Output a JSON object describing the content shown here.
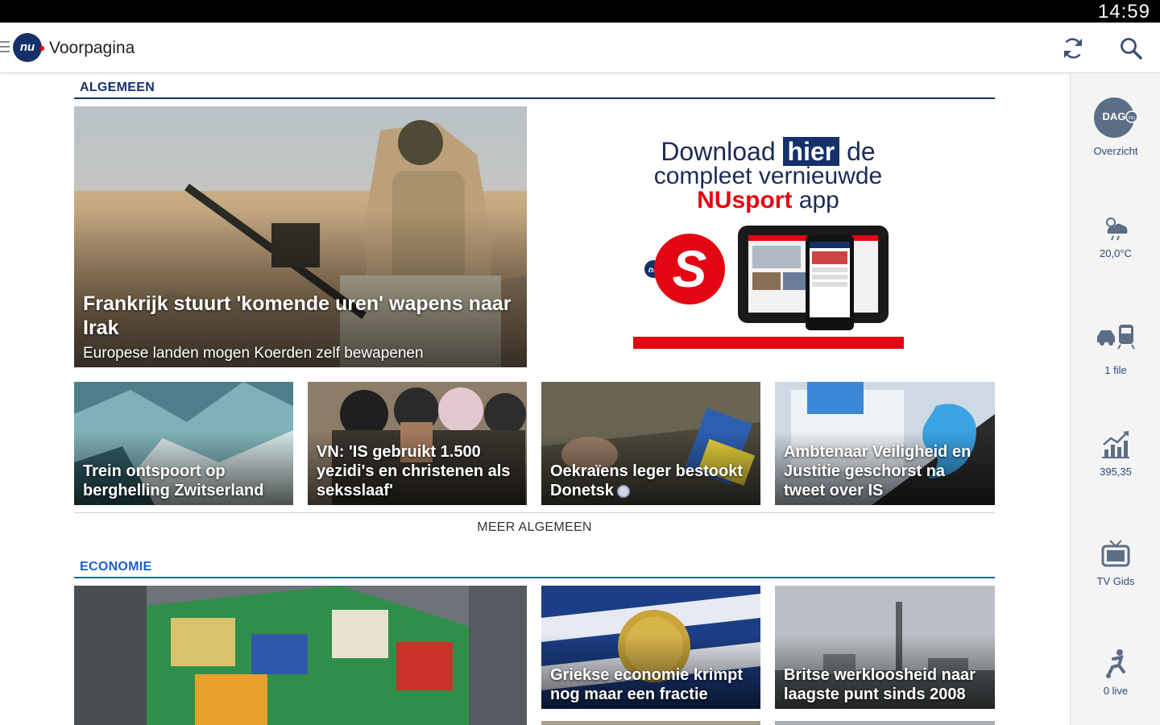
{
  "status_bar": {
    "time": "14:59"
  },
  "app_bar": {
    "logo_text": "nu",
    "title": "Voorpagina"
  },
  "sections": {
    "algemeen": {
      "title": "ALGEMEEN",
      "color": "#15306a",
      "lead": {
        "headline": "Frankrijk stuurt 'komende uren' wapens naar Irak",
        "subtitle": "Europese landen mogen Koerden zelf bewapenen"
      },
      "tiles": [
        {
          "headline": "Trein ontspoort op berghelling Zwitserland"
        },
        {
          "headline": "VN: 'IS gebruikt 1.500 yezidi's en christenen als seksslaaf'"
        },
        {
          "headline": "Oekraïens leger bestookt Donetsk"
        },
        {
          "headline": "Ambtenaar Veiligheid en Justitie geschorst na tweet over IS"
        }
      ],
      "more_label": "MEER ALGEMEEN"
    },
    "economie": {
      "title": "ECONOMIE",
      "color": "#1a5fd1",
      "tiles": [
        {
          "headline": ""
        },
        {
          "headline": "Griekse economie krimpt nog maar een fractie"
        },
        {
          "headline": "Britse werkloosheid naar laagste punt sinds 2008"
        }
      ]
    }
  },
  "ad": {
    "line1_pre": "Download ",
    "line1_highlight": "hier",
    "line1_post": " de",
    "line2": "compleet vernieuwde",
    "line3_brand": "NUsport",
    "line3_post": " app",
    "badge_letter": "S",
    "badge_small": "nu",
    "brand_color": "#e30613"
  },
  "side_rail": [
    {
      "icon": "dag-nu-icon",
      "label": "Overzicht",
      "icon_text": "DAG",
      "icon_sub": "nu"
    },
    {
      "icon": "weather-icon",
      "label": "20,0°C"
    },
    {
      "icon": "traffic-icon",
      "label": "1 file"
    },
    {
      "icon": "stocks-icon",
      "label": "395,35"
    },
    {
      "icon": "tv-icon",
      "label": "TV Gids"
    },
    {
      "icon": "sport-icon",
      "label": "0 live"
    }
  ]
}
